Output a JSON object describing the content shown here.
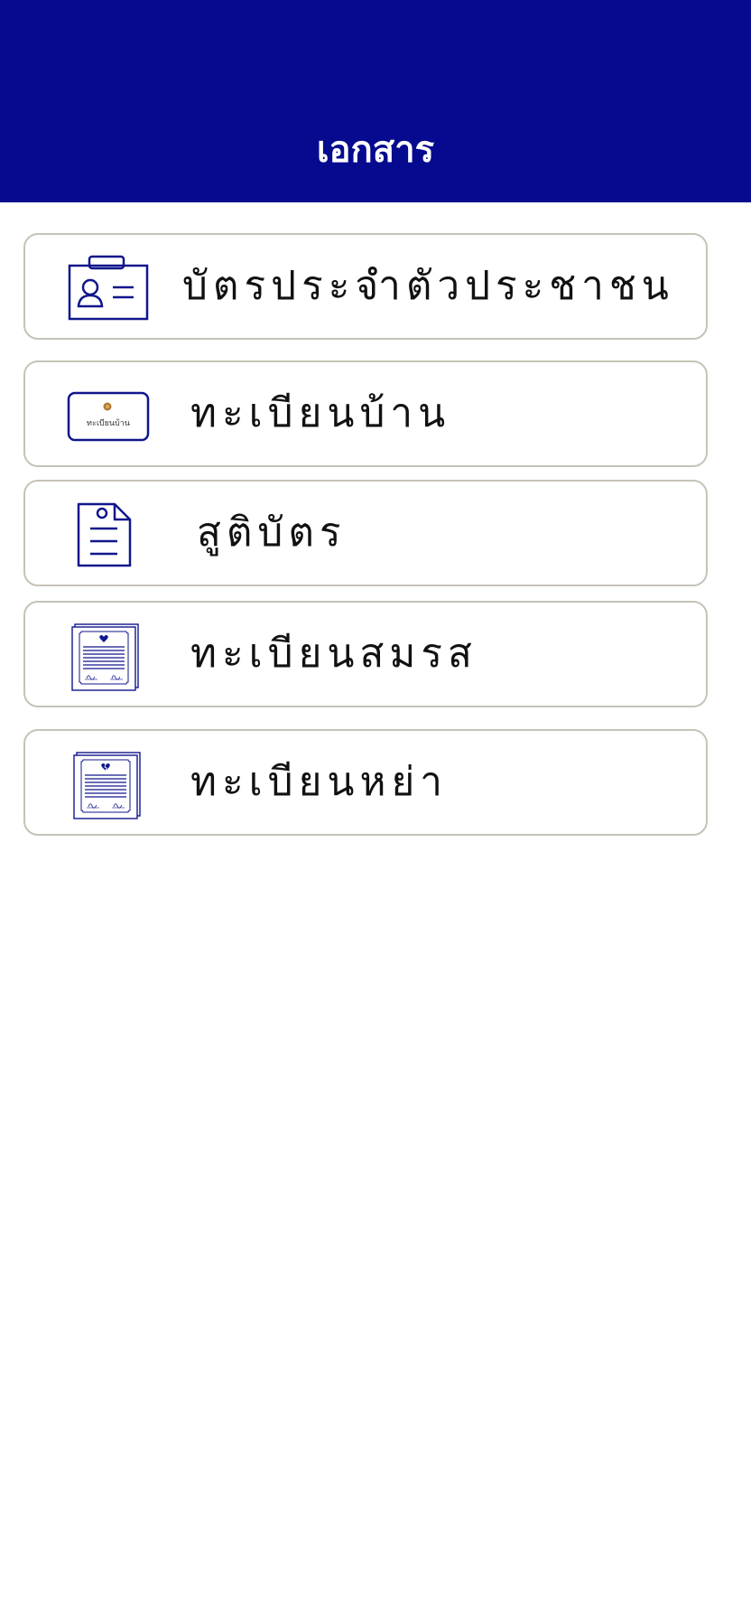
{
  "header": {
    "title": "เอกสาร",
    "background": "#050a8f"
  },
  "accent_color": "#10168c",
  "documents": [
    {
      "label": "บัตรประจำตัวประชาชน",
      "icon": "id-card-icon"
    },
    {
      "label": "ทะเบียนบ้าน",
      "icon": "house-registration-icon",
      "icon_text": "ทะเบียนบ้าน"
    },
    {
      "label": "สูติบัตร",
      "icon": "birth-certificate-icon"
    },
    {
      "label": "ทะเบียนสมรส",
      "icon": "marriage-certificate-icon"
    },
    {
      "label": "ทะเบียนหย่า",
      "icon": "divorce-certificate-icon"
    }
  ]
}
